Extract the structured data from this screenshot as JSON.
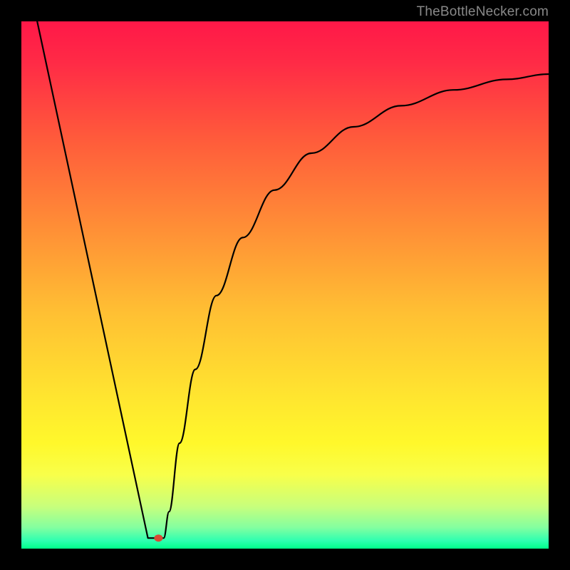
{
  "watermark": "TheBottleNecker.com",
  "chart_data": {
    "type": "line",
    "title": "",
    "xlabel": "",
    "ylabel": "",
    "xlim": [
      0,
      100
    ],
    "ylim": [
      0,
      100
    ],
    "grid": false,
    "gradient_stops": [
      {
        "offset": 0,
        "color": "#ff1848"
      },
      {
        "offset": 0.08,
        "color": "#ff2b46"
      },
      {
        "offset": 0.22,
        "color": "#ff5a3b"
      },
      {
        "offset": 0.4,
        "color": "#ff9136"
      },
      {
        "offset": 0.55,
        "color": "#ffbf33"
      },
      {
        "offset": 0.72,
        "color": "#ffe72f"
      },
      {
        "offset": 0.8,
        "color": "#fff82b"
      },
      {
        "offset": 0.86,
        "color": "#f8ff4a"
      },
      {
        "offset": 0.92,
        "color": "#c8ff7c"
      },
      {
        "offset": 0.96,
        "color": "#83ffa0"
      },
      {
        "offset": 0.985,
        "color": "#2effb0"
      },
      {
        "offset": 1.0,
        "color": "#00ff8a"
      }
    ],
    "series": [
      {
        "name": "curve",
        "piecewise_model": {
          "left_line": {
            "x0": 3,
            "y0": 100,
            "x1": 24,
            "y1": 2
          },
          "valley": {
            "x_min": 24,
            "x_max": 27,
            "y": 2
          },
          "right_curve_points": [
            {
              "x": 27,
              "y": 2
            },
            {
              "x": 28,
              "y": 7
            },
            {
              "x": 30,
              "y": 20
            },
            {
              "x": 33,
              "y": 34
            },
            {
              "x": 37,
              "y": 48
            },
            {
              "x": 42,
              "y": 59
            },
            {
              "x": 48,
              "y": 68
            },
            {
              "x": 55,
              "y": 75
            },
            {
              "x": 63,
              "y": 80
            },
            {
              "x": 72,
              "y": 84
            },
            {
              "x": 82,
              "y": 87
            },
            {
              "x": 92,
              "y": 89
            },
            {
              "x": 100,
              "y": 90
            }
          ]
        }
      }
    ],
    "marker": {
      "x": 26,
      "y": 2,
      "rx": 6,
      "ry": 5,
      "color": "#d84a34"
    }
  }
}
